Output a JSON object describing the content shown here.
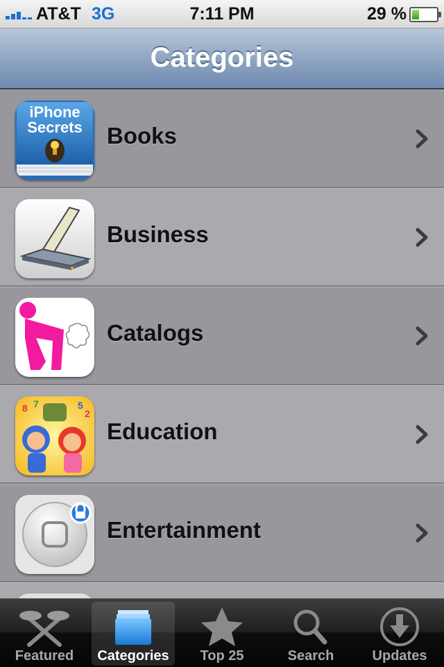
{
  "status": {
    "carrier": "AT&T",
    "network": "3G",
    "time": "7:11 PM",
    "battery": "29 %",
    "battery_level": 0.29
  },
  "nav": {
    "title": "Categories"
  },
  "categories": [
    {
      "label": "Books",
      "icon": "book-iphone-secrets-icon"
    },
    {
      "label": "Business",
      "icon": "scanner-icon"
    },
    {
      "label": "Catalogs",
      "icon": "pink-figure-icon"
    },
    {
      "label": "Education",
      "icon": "cartoon-kids-icon"
    },
    {
      "label": "Entertainment",
      "icon": "home-button-lock-icon"
    }
  ],
  "book_icon_text": [
    "iPhone",
    "Secrets"
  ],
  "tabs": [
    {
      "label": "Featured",
      "icon": "featured-icon",
      "active": false
    },
    {
      "label": "Categories",
      "icon": "categories-icon",
      "active": true
    },
    {
      "label": "Top 25",
      "icon": "star-icon",
      "active": false
    },
    {
      "label": "Search",
      "icon": "search-icon",
      "active": false
    },
    {
      "label": "Updates",
      "icon": "download-icon",
      "active": false
    }
  ],
  "colors": {
    "nav_gradient_top": "#b9c8db",
    "nav_gradient_bottom": "#6f8bb0",
    "row_dark": "#97979d",
    "row_light": "#a9a9ae",
    "accent_blue": "#1c6ed6"
  }
}
